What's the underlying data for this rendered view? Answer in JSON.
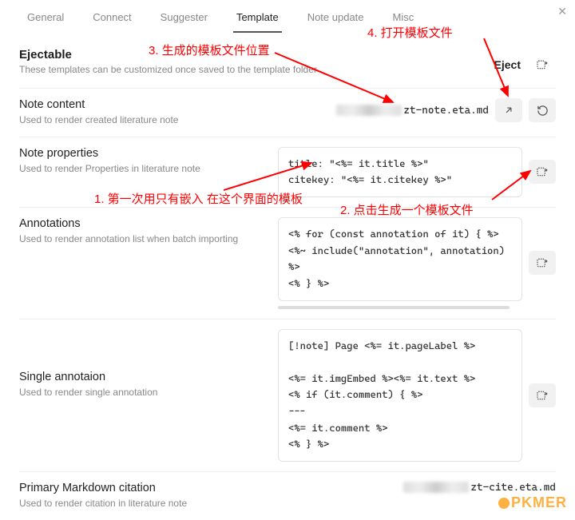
{
  "tabs": {
    "general": "General",
    "connect": "Connect",
    "suggester": "Suggester",
    "template": "Template",
    "noteupdate": "Note update",
    "misc": "Misc"
  },
  "header": {
    "title": "Ejectable",
    "desc": "These templates can be customized once saved to the template folder",
    "eject": "Eject"
  },
  "rows": {
    "noteContent": {
      "title": "Note content",
      "desc": "Used to render created literature note",
      "filename": "zt-note.eta.md"
    },
    "noteProps": {
      "title": "Note properties",
      "desc": "Used to render Properties in literature note",
      "code": "title: \"<%= it.title %>\"\ncitekey: \"<%= it.citekey %>\""
    },
    "annotations": {
      "title": "Annotations",
      "desc": "Used to render annotation list when batch importing",
      "code": "<% for (const annotation of it) { %>\n<%~ include(\"annotation\", annotation) %>\n<% } %>"
    },
    "singleAnnot": {
      "title": "Single annotaion",
      "desc": "Used to render single annotation",
      "code": "[!note] Page <%= it.pageLabel %>\n\n<%= it.imgEmbed %><%= it.text %>\n<% if (it.comment) { %>\n---\n<%= it.comment %>\n<% } %>"
    },
    "primaryCite": {
      "title": "Primary Markdown citation",
      "desc": "Used to render citation in literature note",
      "filename": "zt-cite.eta.md"
    }
  },
  "annotations": {
    "a1": "1. 第一次用只有嵌入\n在这个界面的模板",
    "a2": "2. 点击生成一个模板文件",
    "a3": "3. 生成的模板文件位置",
    "a4": "4. 打开模板文件"
  },
  "watermark": "PKMER"
}
